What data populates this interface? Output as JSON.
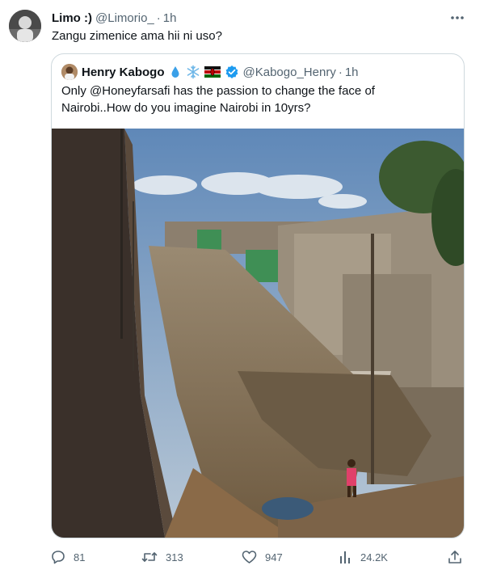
{
  "tweet": {
    "author_name": "Limo :)",
    "author_handle": "@Limorio_",
    "separator": "·",
    "time": "1h",
    "text": "Zangu zimenice ama hii ni uso?"
  },
  "quote": {
    "author_name": "Henry Kabogo",
    "author_handle": "@Kabogo_Henry",
    "separator": "·",
    "time": "1h",
    "text_line1": "Only @Honeyfarsafi has the passion to change the face of",
    "text_line2": "Nairobi..How do you imagine Nairobi in 10yrs?",
    "emoji": [
      "droplet-emoji",
      "snowflake-emoji",
      "kenya-flag-emoji"
    ],
    "verified": true
  },
  "actions": {
    "reply_count": "81",
    "retweet_count": "313",
    "like_count": "947",
    "view_count": "24.2K"
  },
  "colors": {
    "text_primary": "#0f1419",
    "text_secondary": "#536471",
    "border": "#cfd9de",
    "verified_blue": "#1d9bf0"
  }
}
